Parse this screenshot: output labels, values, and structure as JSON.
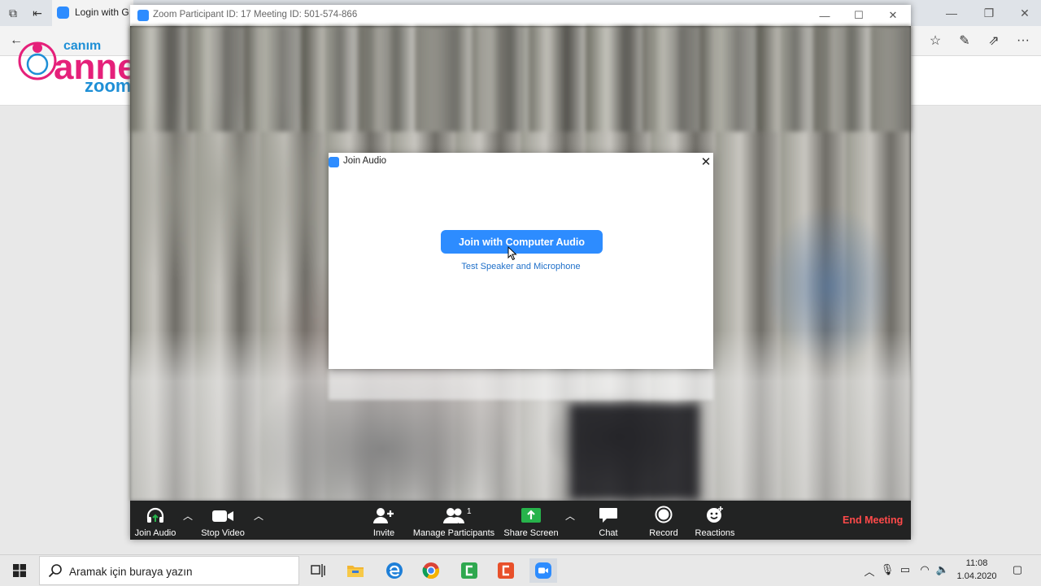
{
  "browser": {
    "tab_title": "Login with G",
    "nav": {
      "back": "←"
    }
  },
  "webpage": {
    "logo_text_small": "canım",
    "logo_text_large": "anne",
    "logo_text_sub": "zoom"
  },
  "zoom_window": {
    "title": "Zoom Participant ID: 17   Meeting ID: 501-574-866"
  },
  "dialog": {
    "title": "Join Audio",
    "primary_button": "Join with Computer Audio",
    "link": "Test Speaker and Microphone"
  },
  "toolbar": {
    "join_audio": "Join Audio",
    "stop_video": "Stop Video",
    "invite": "Invite",
    "manage_participants": "Manage Participants",
    "participants_count": "1",
    "share_screen": "Share Screen",
    "chat": "Chat",
    "record": "Record",
    "reactions": "Reactions",
    "end_meeting": "End Meeting"
  },
  "taskbar": {
    "search_placeholder": "Aramak için buraya yazın",
    "time": "11:08",
    "date": "1.04.2020"
  },
  "colors": {
    "zoom_blue": "#2d8cff",
    "end_meeting_red": "#ff4a4a",
    "share_green": "#27b34b",
    "logo_pink": "#e5207a",
    "logo_blue": "#1e8fd6"
  }
}
